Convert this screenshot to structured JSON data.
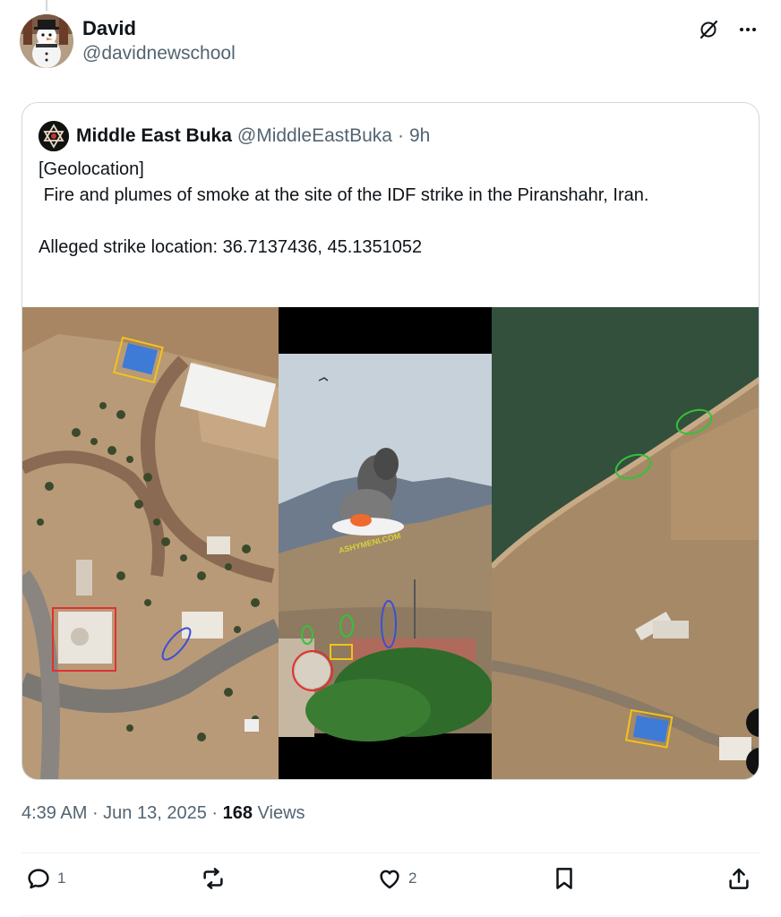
{
  "post": {
    "author": {
      "display_name": "David",
      "handle": "@davidnewschool",
      "avatar_icon": "snowman-avatar"
    },
    "header_icons": [
      "grok-icon",
      "more-icon"
    ],
    "quoted": {
      "display_name": "Middle East Buka",
      "handle": "@MiddleEastBuka",
      "dot": "·",
      "time": "9h",
      "avatar_icon": "star-of-david-avatar",
      "text_line1": "[Geolocation]",
      "text_line2": " Fire and plumes of smoke at the site of the IDF strike in the Piranshahr, Iran.",
      "text_line3": "Alleged strike location: 36.7137436, 45.1351052",
      "media_overlay_text": "ASHYMENI.COM"
    },
    "meta": {
      "time": "4:39 AM",
      "sep1": " · ",
      "date": "Jun 13, 2025",
      "sep2": " · ",
      "views_count": "168",
      "views_label": " Views"
    },
    "actions": {
      "reply_count": "1",
      "repost_count": "",
      "like_count": "2"
    }
  },
  "colors": {
    "text_primary": "#0f1419",
    "text_secondary": "#536471",
    "border": "#cfd9de"
  }
}
